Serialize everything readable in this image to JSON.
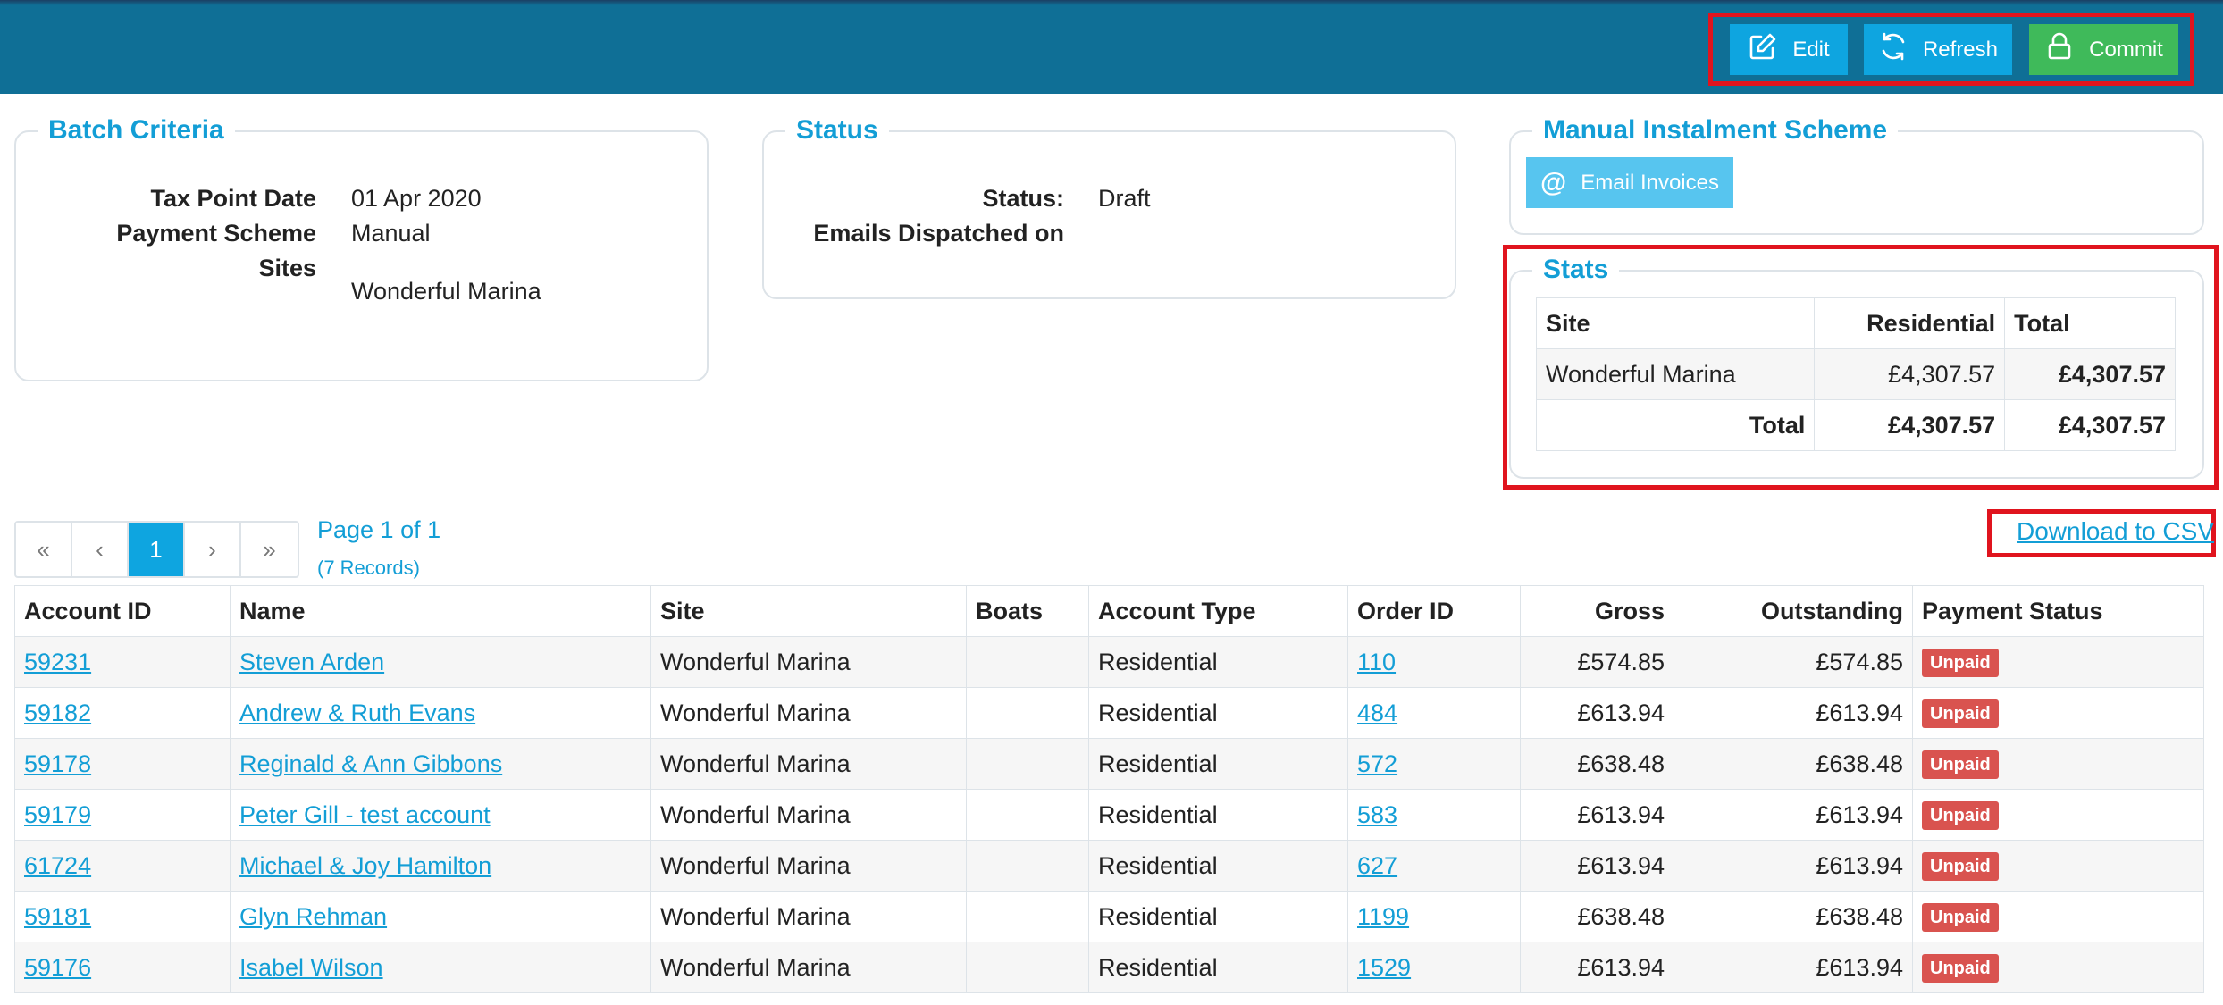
{
  "toolbar": {
    "edit_label": "Edit",
    "refresh_label": "Refresh",
    "commit_label": "Commit"
  },
  "batch_criteria": {
    "title": "Batch Criteria",
    "tax_point_date_label": "Tax Point Date",
    "tax_point_date_value": "01 Apr 2020",
    "payment_scheme_label": "Payment Scheme",
    "payment_scheme_value": "Manual",
    "sites_label": "Sites",
    "sites_value": "Wonderful Marina"
  },
  "status_panel": {
    "title": "Status",
    "status_label": "Status:",
    "status_value": "Draft",
    "emails_label": "Emails Dispatched on",
    "emails_value": ""
  },
  "manual_scheme": {
    "title": "Manual Instalment Scheme",
    "email_invoices_label": "Email Invoices"
  },
  "stats": {
    "title": "Stats",
    "headers": [
      "Site",
      "Residential",
      "Total"
    ],
    "row": {
      "site": "Wonderful Marina",
      "residential": "£4,307.57",
      "total": "£4,307.57"
    },
    "total_row": {
      "label": "Total",
      "residential": "£4,307.57",
      "total": "£4,307.57"
    }
  },
  "pagination": {
    "first": "«",
    "prev": "‹",
    "current": "1",
    "next": "›",
    "last": "»",
    "page_info": "Page 1 of 1",
    "records_info": "(7 Records)"
  },
  "download_csv_label": "Download to CSV",
  "table": {
    "headers": [
      "Account ID",
      "Name",
      "Site",
      "Boats",
      "Account Type",
      "Order ID",
      "Gross",
      "Outstanding",
      "Payment Status"
    ],
    "rows": [
      {
        "account_id": "59231",
        "name": "Steven Arden",
        "site": "Wonderful Marina",
        "boats": "",
        "account_type": "Residential",
        "order_id": "110",
        "gross": "£574.85",
        "outstanding": "£574.85",
        "payment_status": "Unpaid"
      },
      {
        "account_id": "59182",
        "name": "Andrew & Ruth Evans",
        "site": "Wonderful Marina",
        "boats": "",
        "account_type": "Residential",
        "order_id": "484",
        "gross": "£613.94",
        "outstanding": "£613.94",
        "payment_status": "Unpaid"
      },
      {
        "account_id": "59178",
        "name": "Reginald & Ann Gibbons",
        "site": "Wonderful Marina",
        "boats": "",
        "account_type": "Residential",
        "order_id": "572",
        "gross": "£638.48",
        "outstanding": "£638.48",
        "payment_status": "Unpaid"
      },
      {
        "account_id": "59179",
        "name": "Peter Gill - test account",
        "site": "Wonderful Marina",
        "boats": "",
        "account_type": "Residential",
        "order_id": "583",
        "gross": "£613.94",
        "outstanding": "£613.94",
        "payment_status": "Unpaid"
      },
      {
        "account_id": "61724",
        "name": "Michael & Joy Hamilton",
        "site": "Wonderful Marina",
        "boats": "",
        "account_type": "Residential",
        "order_id": "627",
        "gross": "£613.94",
        "outstanding": "£613.94",
        "payment_status": "Unpaid"
      },
      {
        "account_id": "59181",
        "name": "Glyn Rehman",
        "site": "Wonderful Marina",
        "boats": "",
        "account_type": "Residential",
        "order_id": "1199",
        "gross": "£638.48",
        "outstanding": "£638.48",
        "payment_status": "Unpaid"
      },
      {
        "account_id": "59176",
        "name": "Isabel Wilson",
        "site": "Wonderful Marina",
        "boats": "",
        "account_type": "Residential",
        "order_id": "1529",
        "gross": "£613.94",
        "outstanding": "£613.94",
        "payment_status": "Unpaid"
      }
    ]
  },
  "colors": {
    "header_bar": "#0f6f96",
    "accent_blue": "#0ea5e0",
    "commit_green": "#3fba5a",
    "unpaid_red": "#d9534f",
    "highlight_red": "#e0141e"
  },
  "icons": {
    "edit": "edit-icon",
    "refresh": "refresh-icon",
    "commit": "lock-icon",
    "email": "at-icon"
  }
}
